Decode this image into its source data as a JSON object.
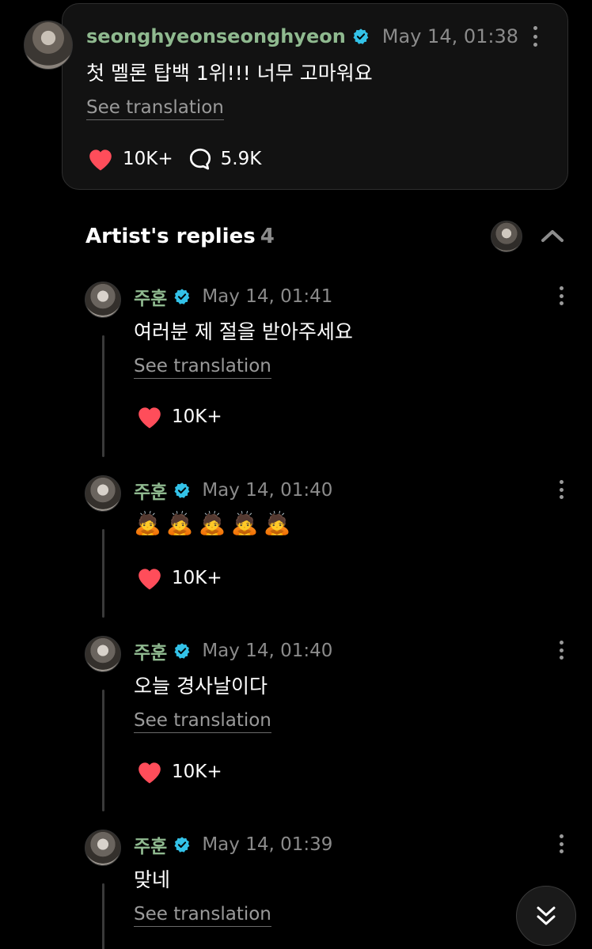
{
  "post": {
    "username": "seonghyeonseonghyeon",
    "time": "May 14, 01:38",
    "text": "첫 멜론 탑백 1위!!! 너무 고마워요",
    "translate_label": "See translation",
    "likes": "10K+",
    "comments": "5.9K"
  },
  "replies_section": {
    "title": "Artist's replies",
    "count": "4"
  },
  "replies": [
    {
      "name": "주훈",
      "time": "May 14, 01:41",
      "text": "여러분 제 절을 받아주세요",
      "translate_label": "See translation",
      "likes": "10K+"
    },
    {
      "name": "주훈",
      "time": "May 14, 01:40",
      "text": "🙇🙇🙇🙇🙇",
      "likes": "10K+"
    },
    {
      "name": "주훈",
      "time": "May 14, 01:40",
      "text": "오늘 경사날이다",
      "translate_label": "See translation",
      "likes": "10K+"
    },
    {
      "name": "주훈",
      "time": "May 14, 01:39",
      "text": "맞네",
      "translate_label": "See translation"
    }
  ],
  "colors": {
    "username": "#8fb98f",
    "verified": "#33c2e8",
    "heart": "#ff4d5a",
    "muted": "#8b8b8b"
  },
  "icons": {
    "verified": "verified-badge-icon",
    "like": "heart-icon",
    "comment": "comment-bubble-icon",
    "more": "more-vertical-icon",
    "collapse": "chevron-up-icon",
    "scroll": "double-chevron-down-icon"
  }
}
